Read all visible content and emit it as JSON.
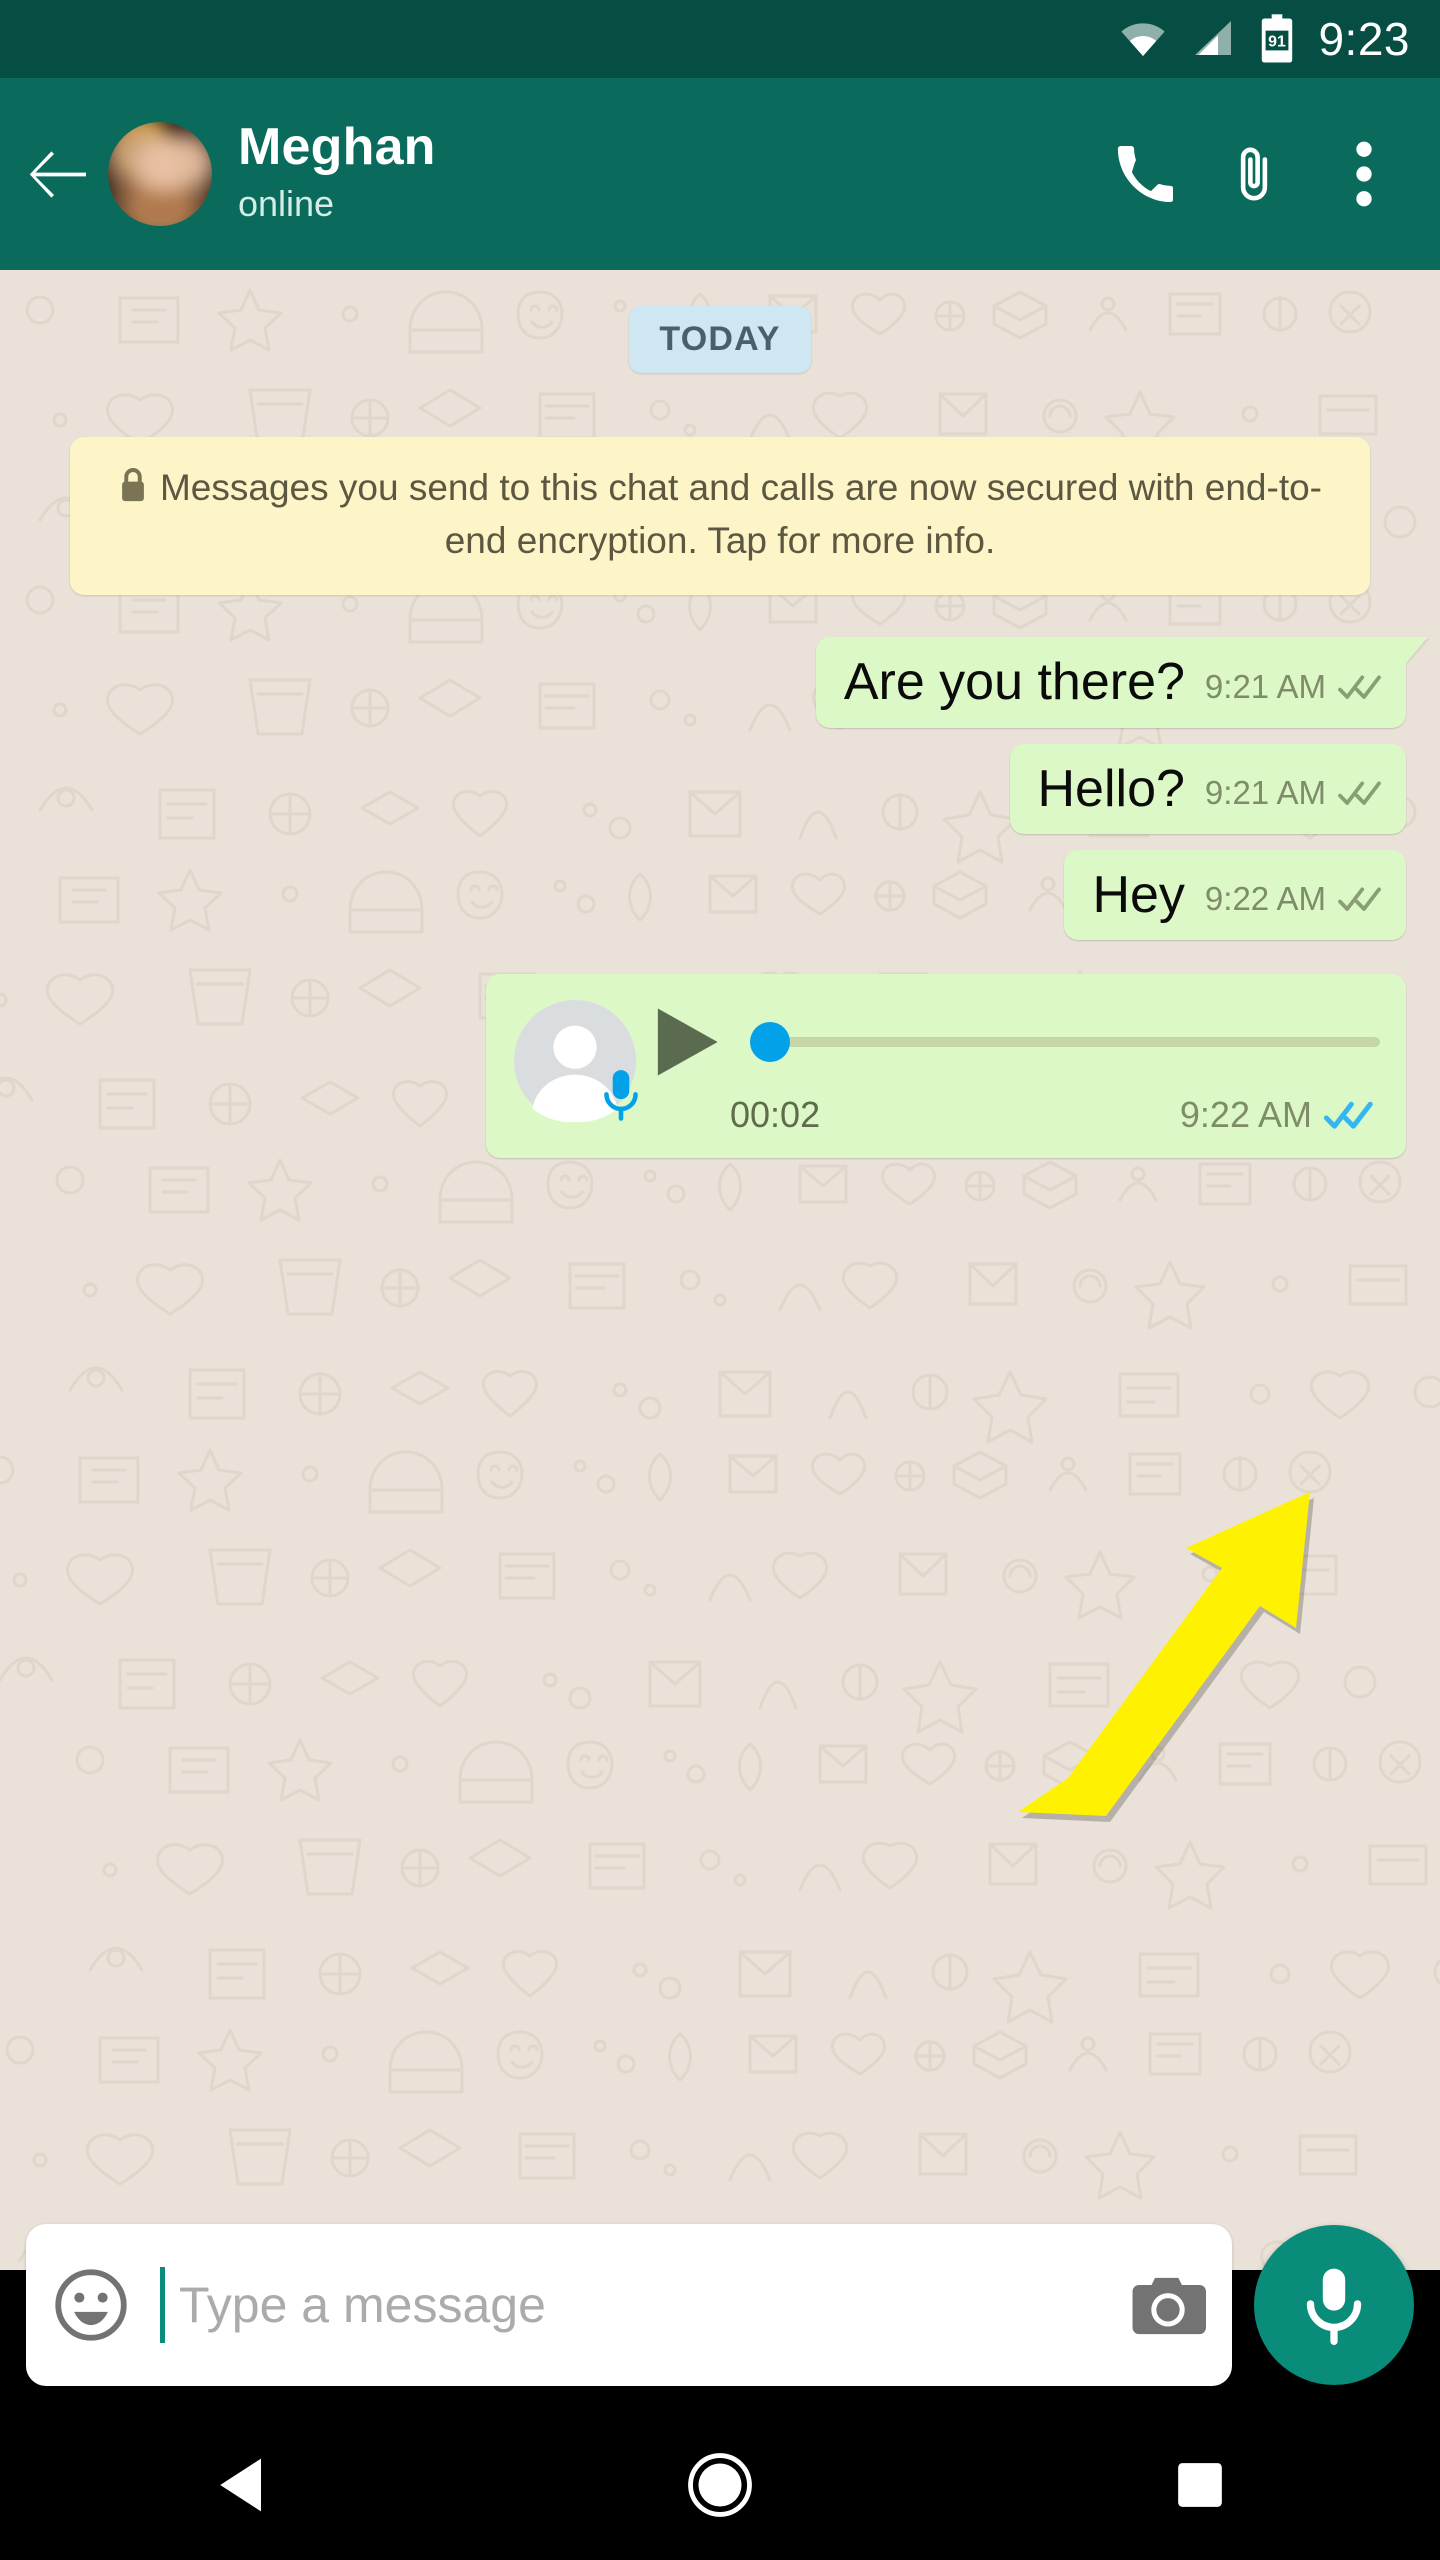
{
  "status_bar": {
    "time": "9:23",
    "battery_level": "91",
    "icons": [
      "wifi-icon",
      "cellular-signal-icon",
      "battery-icon"
    ]
  },
  "app_bar": {
    "back_icon": "back-arrow-icon",
    "avatar": "contact-avatar",
    "title": "Meghan",
    "status": "online",
    "actions": [
      {
        "name": "call-button",
        "icon": "phone-icon"
      },
      {
        "name": "attach-button",
        "icon": "paperclip-icon"
      },
      {
        "name": "overflow-menu-button",
        "icon": "three-dots-icon"
      }
    ]
  },
  "chat": {
    "date_divider": "TODAY",
    "encryption_notice": "Messages you send to this chat and calls are now secured with end-to-end encryption. Tap for more info.",
    "encryption_icon": "lock-icon",
    "messages": [
      {
        "type": "text",
        "text": "Are you there?",
        "time": "9:21 AM",
        "receipt": "delivered",
        "direction": "outgoing"
      },
      {
        "type": "text",
        "text": "Hello?",
        "time": "9:21 AM",
        "receipt": "delivered",
        "direction": "outgoing"
      },
      {
        "type": "text",
        "text": "Hey",
        "time": "9:22 AM",
        "receipt": "delivered",
        "direction": "outgoing"
      },
      {
        "type": "voice",
        "duration": "00:02",
        "time": "9:22 AM",
        "receipt": "read",
        "direction": "outgoing",
        "progress": 0
      }
    ]
  },
  "annotation": {
    "shape": "arrow",
    "color": "#FFF200",
    "points_to": "voice-message-read-receipt"
  },
  "input_bar": {
    "emoji_icon": "emoji-smiley-icon",
    "placeholder": "Type a message",
    "value": "",
    "camera_icon": "camera-icon",
    "mic_icon": "microphone-icon"
  },
  "nav_bar": {
    "back": "nav-back-icon",
    "home": "nav-home-icon",
    "recents": "nav-recents-icon"
  },
  "colors": {
    "status_bar": "#064E44",
    "app_bar": "#0A6B5D",
    "chat_bg": "#EAE2D8",
    "bubble_out": "#DCF8C6",
    "date_chip": "#CFE6F3",
    "encryption_note": "#FDF4C8",
    "accent_teal": "#0A8C7A",
    "receipt_read": "#34B7F1",
    "receipt_delivered": "#8A9E76",
    "annotation": "#FFF200"
  }
}
